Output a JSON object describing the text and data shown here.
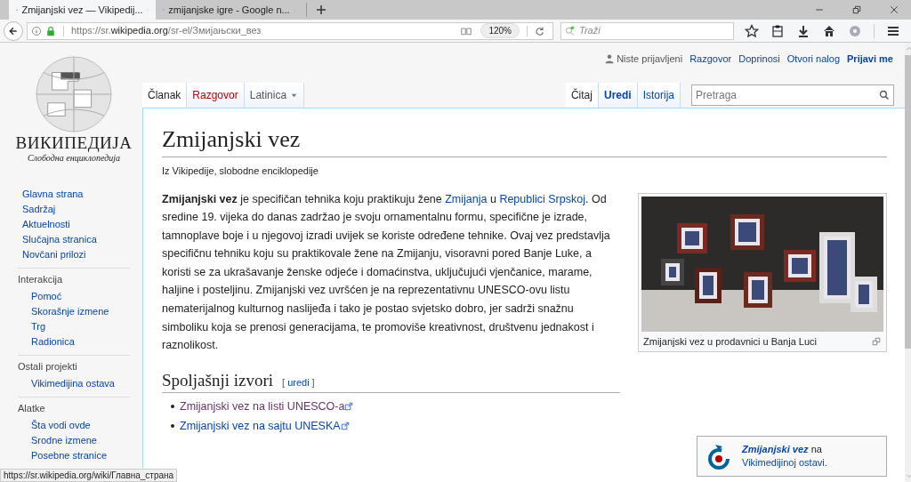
{
  "browser": {
    "tabs": [
      {
        "title": "Zmijanjski vez — Vikipedij...",
        "selected": true,
        "kind": "wiki"
      },
      {
        "title": "zmijanjske igre - Google n...",
        "selected": false,
        "kind": "google"
      }
    ],
    "url": "https://sr.**wikipedia.org**/sr-el/Змијањски_вез",
    "zoom": "120%",
    "search_placeholder": "Traži"
  },
  "personal_menu": {
    "status": "Niste prijavljeni",
    "links": [
      {
        "label": "Razgovor",
        "bold": false
      },
      {
        "label": "Doprinosi",
        "bold": false
      },
      {
        "label": "Otvori nalog",
        "bold": false
      },
      {
        "label": "Prijavi me",
        "bold": true
      }
    ]
  },
  "logo": {
    "wordmark": "ВИКИПЕДИЈА",
    "tagline": "Слободна енциклопедија"
  },
  "left_tabs": [
    {
      "label": "Članak",
      "selected": true,
      "missing": false,
      "kind": "tab"
    },
    {
      "label": "Razgovor",
      "selected": false,
      "missing": true,
      "kind": "tab"
    },
    {
      "label": "Latinica",
      "selected": false,
      "missing": false,
      "kind": "dropdown"
    }
  ],
  "right_tabs": [
    {
      "label": "Čitaj",
      "selected": true,
      "bold": false
    },
    {
      "label": "Uredi",
      "selected": false,
      "bold": true
    },
    {
      "label": "Istorija",
      "selected": false,
      "bold": false
    }
  ],
  "search": {
    "placeholder": "Pretraga"
  },
  "sidebar": {
    "main": [
      "Glavna strana",
      "Sadržaj",
      "Aktuelnosti",
      "Slučajna stranica",
      "Novčani prilozi"
    ],
    "portals": [
      {
        "heading": "Interakcija",
        "items": [
          "Pomoć",
          "Skorašnje izmene",
          "Trg",
          "Radionica"
        ]
      },
      {
        "heading": "Ostali projekti",
        "items": [
          "Vikimedijina ostava"
        ]
      },
      {
        "heading": "Alatke",
        "items": [
          "Šta vodi ovde",
          "Srodne izmene",
          "Posebne stranice"
        ]
      }
    ]
  },
  "article": {
    "title": "Zmijanjski vez",
    "subtitle": "Iz Vikipedije, slobodne enciklopedije",
    "paragraph": [
      {
        "kind": "bold",
        "text": "Zmijanjski vez"
      },
      {
        "kind": "text",
        "text": " je specifičan tehnika koju praktikuju žene "
      },
      {
        "kind": "link",
        "text": "Zmijanja"
      },
      {
        "kind": "text",
        "text": " u "
      },
      {
        "kind": "link",
        "text": "Republici Srpskoj"
      },
      {
        "kind": "text",
        "text": ". Od sredine 19. vijeka do danas zadržao je svoju ornamentalnu formu, specifične je izrade, tamnoplave boje i u njegovoj izradi uvijek se koriste određene tehnike. Ovaj vez predstavlja specifičnu tehniku koju su praktikovale žene na Zmijanju, visoravni pored Banje Luke, a koristi se za ukrašavanje ženske odjeće i domaćinstva, uključujući vjenčanice, marame, haljine i posteljinu. Zmijanjski vez uvršćen je na reprezentativnu UNESCO-ovu listu nematerijalnog kulturnog naslijeđa i tako je postao svjetsko dobro, jer sadrži snažnu simboliku koja se prenosi generacijama, te promoviše kreativnost, društvenu jednakost i raznolikost."
      }
    ],
    "figure": {
      "caption": "Zmijanjski vez u prodavnici u Banja Luci"
    },
    "section": {
      "heading": "Spoljašnji izvori",
      "edit_open": "[",
      "edit_label": "uredi",
      "edit_close": "]"
    },
    "external_links": [
      {
        "label": "Zmijanjski vez na listi UNESCO-a",
        "visited": true
      },
      {
        "label": "Zmijanjski vez na sajtu UNESKA",
        "visited": false
      }
    ],
    "commons": {
      "title": "Zmijanjski vez",
      "middle": "na",
      "link": "Vikimedijinoj ostavi."
    }
  },
  "status_url": "https://sr.wikipedia.org/wiki/Главна_страна"
}
